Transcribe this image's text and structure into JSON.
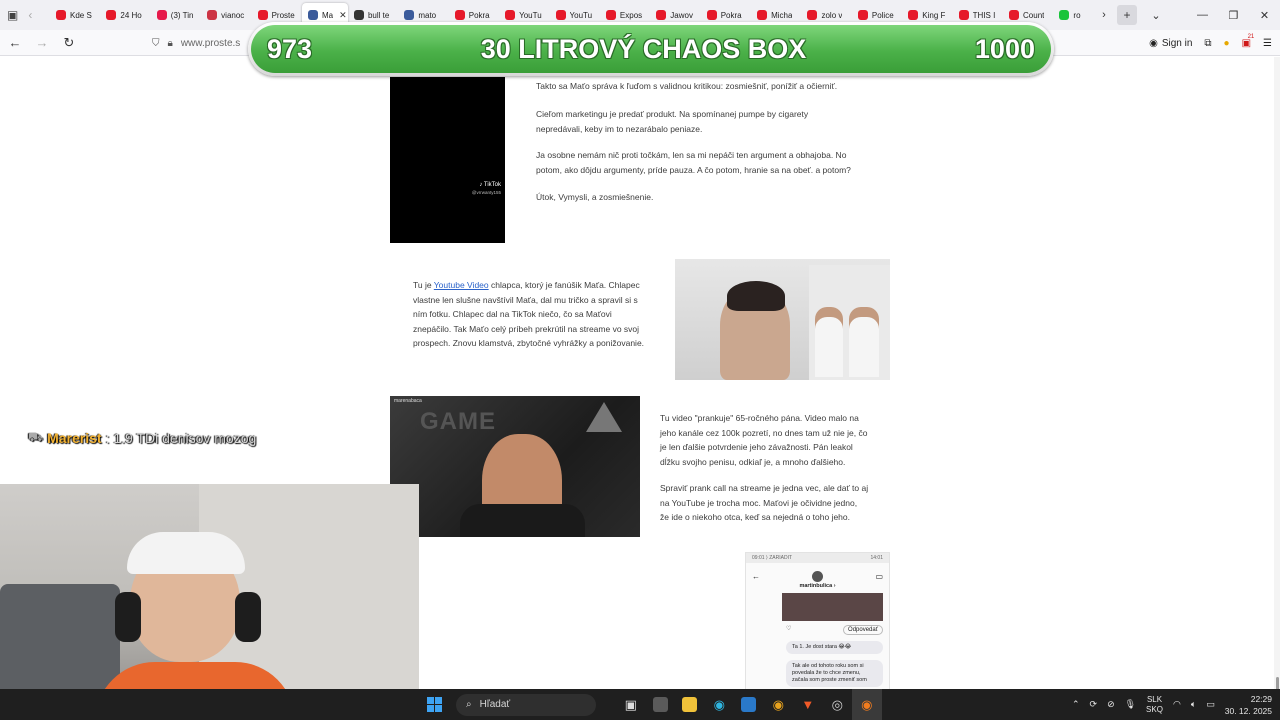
{
  "browser": {
    "tabs": [
      {
        "title": "Kde S",
        "color": "#e6192a"
      },
      {
        "title": "24 Ho",
        "color": "#e6192a"
      },
      {
        "title": "(3) Tin",
        "color": "#e6194b"
      },
      {
        "title": "vianoc",
        "color": "#cc3344"
      },
      {
        "title": "Proste",
        "color": "#e6192a"
      },
      {
        "title": "Ma",
        "color": "#3b5b9b",
        "active": true
      },
      {
        "title": "bull te",
        "color": "#333333"
      },
      {
        "title": "mato",
        "color": "#3b5b9b"
      },
      {
        "title": "Pokra",
        "color": "#e6192a"
      },
      {
        "title": "YouTu",
        "color": "#e6192a"
      },
      {
        "title": "YouTu",
        "color": "#e6192a"
      },
      {
        "title": "Expos",
        "color": "#e6192a"
      },
      {
        "title": "Jawov",
        "color": "#e6192a"
      },
      {
        "title": "Pokra",
        "color": "#e6192a"
      },
      {
        "title": "Micha",
        "color": "#e6192a"
      },
      {
        "title": "zolo v",
        "color": "#e6192a"
      },
      {
        "title": "Police",
        "color": "#e6192a"
      },
      {
        "title": "King F",
        "color": "#e6192a"
      },
      {
        "title": "THIS I",
        "color": "#e6192a"
      },
      {
        "title": "Count",
        "color": "#e6192a"
      },
      {
        "title": "ro",
        "color": "#19c43a"
      }
    ],
    "url": "www.proste.s",
    "sign_in": "Sign in",
    "ext_badge": "21"
  },
  "banner": {
    "left_value": "973",
    "title": "30 LITROVÝ CHAOS BOX",
    "right_value": "1000"
  },
  "article": {
    "p1": "Takto sa Maťo správa k ľuďom s validnou kritikou: zosmiešniť, ponížiť a očierniť.",
    "p2_line1": "Cieľom marketingu je predať produkt. Na spomínanej pumpe by cigarety",
    "p2_line2": "nepredávali, keby im to nezarábalo peniaze.",
    "p3_line1": "Ja osobne nemám nič proti točkám, len sa mi nepáči ten argument a obhajoba. No",
    "p3_line2": "potom, ako dôjdu argumenty, príde pauza. A čo potom, hranie sa na obeť. a potom?",
    "p4": "Útok, Vymysli, a zosmiešnenie.",
    "tiktok_watermark": "♪ TikTok",
    "tiktok_handle": "@vrrwanty155",
    "p5_prefix": "Tu je ",
    "p5_link": "Youtube Video",
    "p5_line1_rest": " chlapca, ktorý je fanúšik Maťa. Chlapec",
    "p5_line2": "vlastne len slušne navštívil Maťa, dal mu tričko a spravil si s",
    "p5_line3": "ním fotku. Chlapec dal na TikTok niečo, čo sa Maťovi",
    "p5_line4": "znepáčilo. Tak Maťo celý príbeh prekrútil na streame vo svoj",
    "p5_line5": "prospech. Znovu klamstvá, zbytočné vyhrážky a ponižovanie.",
    "p6_line1": "Tu video \"prankuje\" 65-ročného pána. Video malo na",
    "p6_line2": "jeho kanále cez 100k pozretí, no dnes tam už nie je, čo",
    "p6_line3": "je len ďalšie potvrdenie jeho závažnosti. Pán leakol",
    "p6_line4": "dĺžku svojho penisu, odkiaľ je, a mnoho ďalšieho.",
    "p7_line1": "Spraviť prank call na streame je jedna vec, ale dať to aj",
    "p7_line2": "na YouTube je trocha moc. Maťovi je očividne jedno,",
    "p7_line3": "že ide o niekoho otca, keď sa nejedná o toho jeho.",
    "stream_sticker": "GAME",
    "stream_channel": "marenabaca",
    "phone": {
      "status_left": "09:01 ⟩ ZARIADIT",
      "status_right": "14:01",
      "username": "martinbulica ›",
      "reply_button": "Odpovedať",
      "bubble1": "Ta 1. Je dost stara 😂😂",
      "bubble2": "Tak ale od tohoto roku som si povedala že to chce zmenu, začala som proste zmeniť som"
    }
  },
  "chat": {
    "user": "Marerist",
    "message": ": 1.9 TDi denisov mozog"
  },
  "taskbar": {
    "search_placeholder": "Hľadať",
    "lang_top": "SLK",
    "lang_bottom": "SKQ",
    "time": "22:29",
    "date": "30. 12. 2025"
  }
}
